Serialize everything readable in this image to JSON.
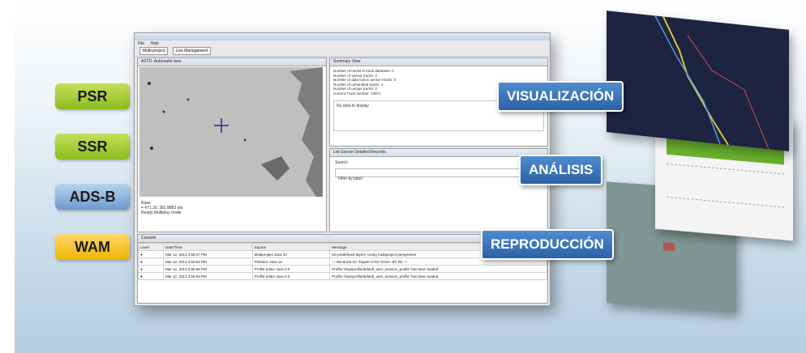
{
  "badges": [
    {
      "label": "PSR",
      "color": "#9cc52e"
    },
    {
      "label": "SSR",
      "color": "#9cc52e"
    },
    {
      "label": "ADS-B",
      "color": "#85acd8"
    },
    {
      "label": "WAM",
      "color": "#f5c023"
    }
  ],
  "stage_labels": {
    "visualizacion": "VISUALIZACIÓN",
    "analisis": "ANÁLISIS",
    "reproduccion": "REPRODUCCIÓN"
  },
  "window": {
    "title": "",
    "menu": [
      "File",
      "Help"
    ],
    "perspectives": [
      "Multi-project",
      "Live Management"
    ],
    "map_tab": "ASTD: Automatik view",
    "summary_tab": "Summary View",
    "summary_lines": [
      "Number of tracks in track database: 0",
      "Number of sensor tracks: 0",
      "Number of data fusion sensor tracks: 0",
      "Number of unhandled tracks: 1",
      "Number of unique tracks: 0",
      "Current Track number: 13871"
    ],
    "no_data": "No data to display",
    "list_tab": "List Sensor Detailed Records",
    "search_label": "Search",
    "filter_text": "Filter by label",
    "coords": [
      "Base:",
      "= 471.30, 381.8883 pts",
      "Ready Multiplay mode"
    ],
    "console_tab": "Console",
    "console_headers": [
      "Level",
      "Date/Time",
      "Source",
      "Message"
    ],
    "console_rows": [
      [
        "Mar 12, 2013 3:56:47 PM",
        "Multiproject Java 10",
        "No predefined layers. Using multiproject perspective"
      ],
      [
        "Mar 12, 2013 3:56:52 PM",
        "Filtration Java 16",
        "— Windows-10 'Tripple-1746' Driver -60' list —"
      ],
      [
        "Mar 12, 2013 3:56:58 PM",
        "Profile editor Java 3.0",
        "Profile '/tmp/profile/default_user_session_profile' has been loaded"
      ],
      [
        "Mar 12, 2013 3:56:59 PM",
        "Profile editor Java 3.0",
        "Profile '/tmp/profile/default_user_session_profile' has been loaded"
      ]
    ]
  }
}
